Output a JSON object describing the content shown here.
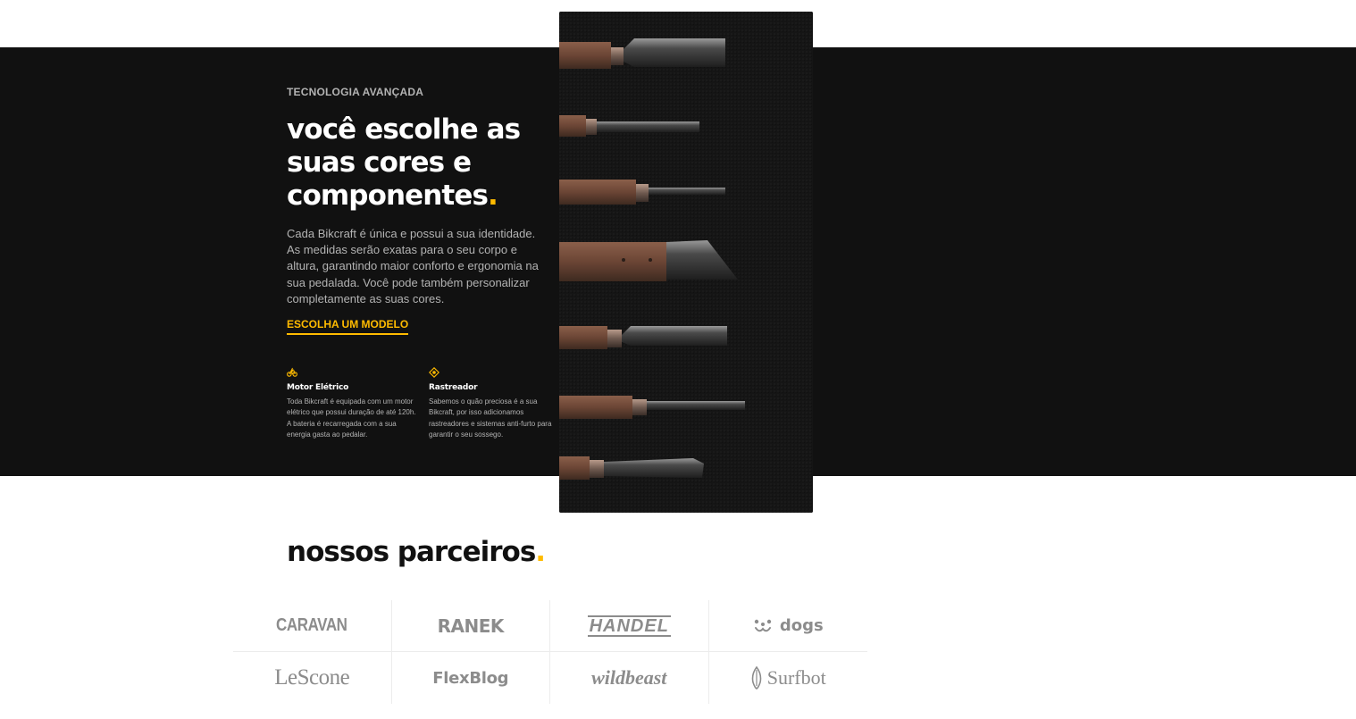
{
  "technology": {
    "eyebrow": "TECNOLOGIA AVANÇADA",
    "headline": "você escolhe as suas cores e componentes",
    "headline_dot": ".",
    "description": "Cada Bikcraft é única e possui a sua identidade. As medidas serão exatas para o seu corpo e altura, garantindo maior conforto e ergonomia na sua pedalada. Você pode também personalizar completamente as suas cores.",
    "cta_label": "ESCOLHA UM MODELO",
    "features": [
      {
        "icon": "electric-bike-icon",
        "title": "Motor Elétrico",
        "text": "Toda Bikcraft é equipada com um motor elétrico que possui duração de até 120h. A bateria é recarregada com a sua energia gasta ao pedalar."
      },
      {
        "icon": "location-pin-icon",
        "title": "Rastreador",
        "text": "Sabemos o quão preciosa é a sua Bikcraft, por isso adicionamos rastreadores e sistemas anti-furto para garantir o seu sossego."
      }
    ]
  },
  "partners": {
    "title": "nossos parceiros",
    "title_dot": ".",
    "logos": [
      "CARAVAN",
      "RANEK",
      "HANDEL",
      "dogs",
      "LeScone",
      "FlexBlog",
      "wildbeast",
      "Surfbot"
    ]
  },
  "colors": {
    "accent": "#ffbb00",
    "dark_background": "#111111",
    "muted_text": "#b3b3b3",
    "logo_gray": "#8c8c8c"
  }
}
